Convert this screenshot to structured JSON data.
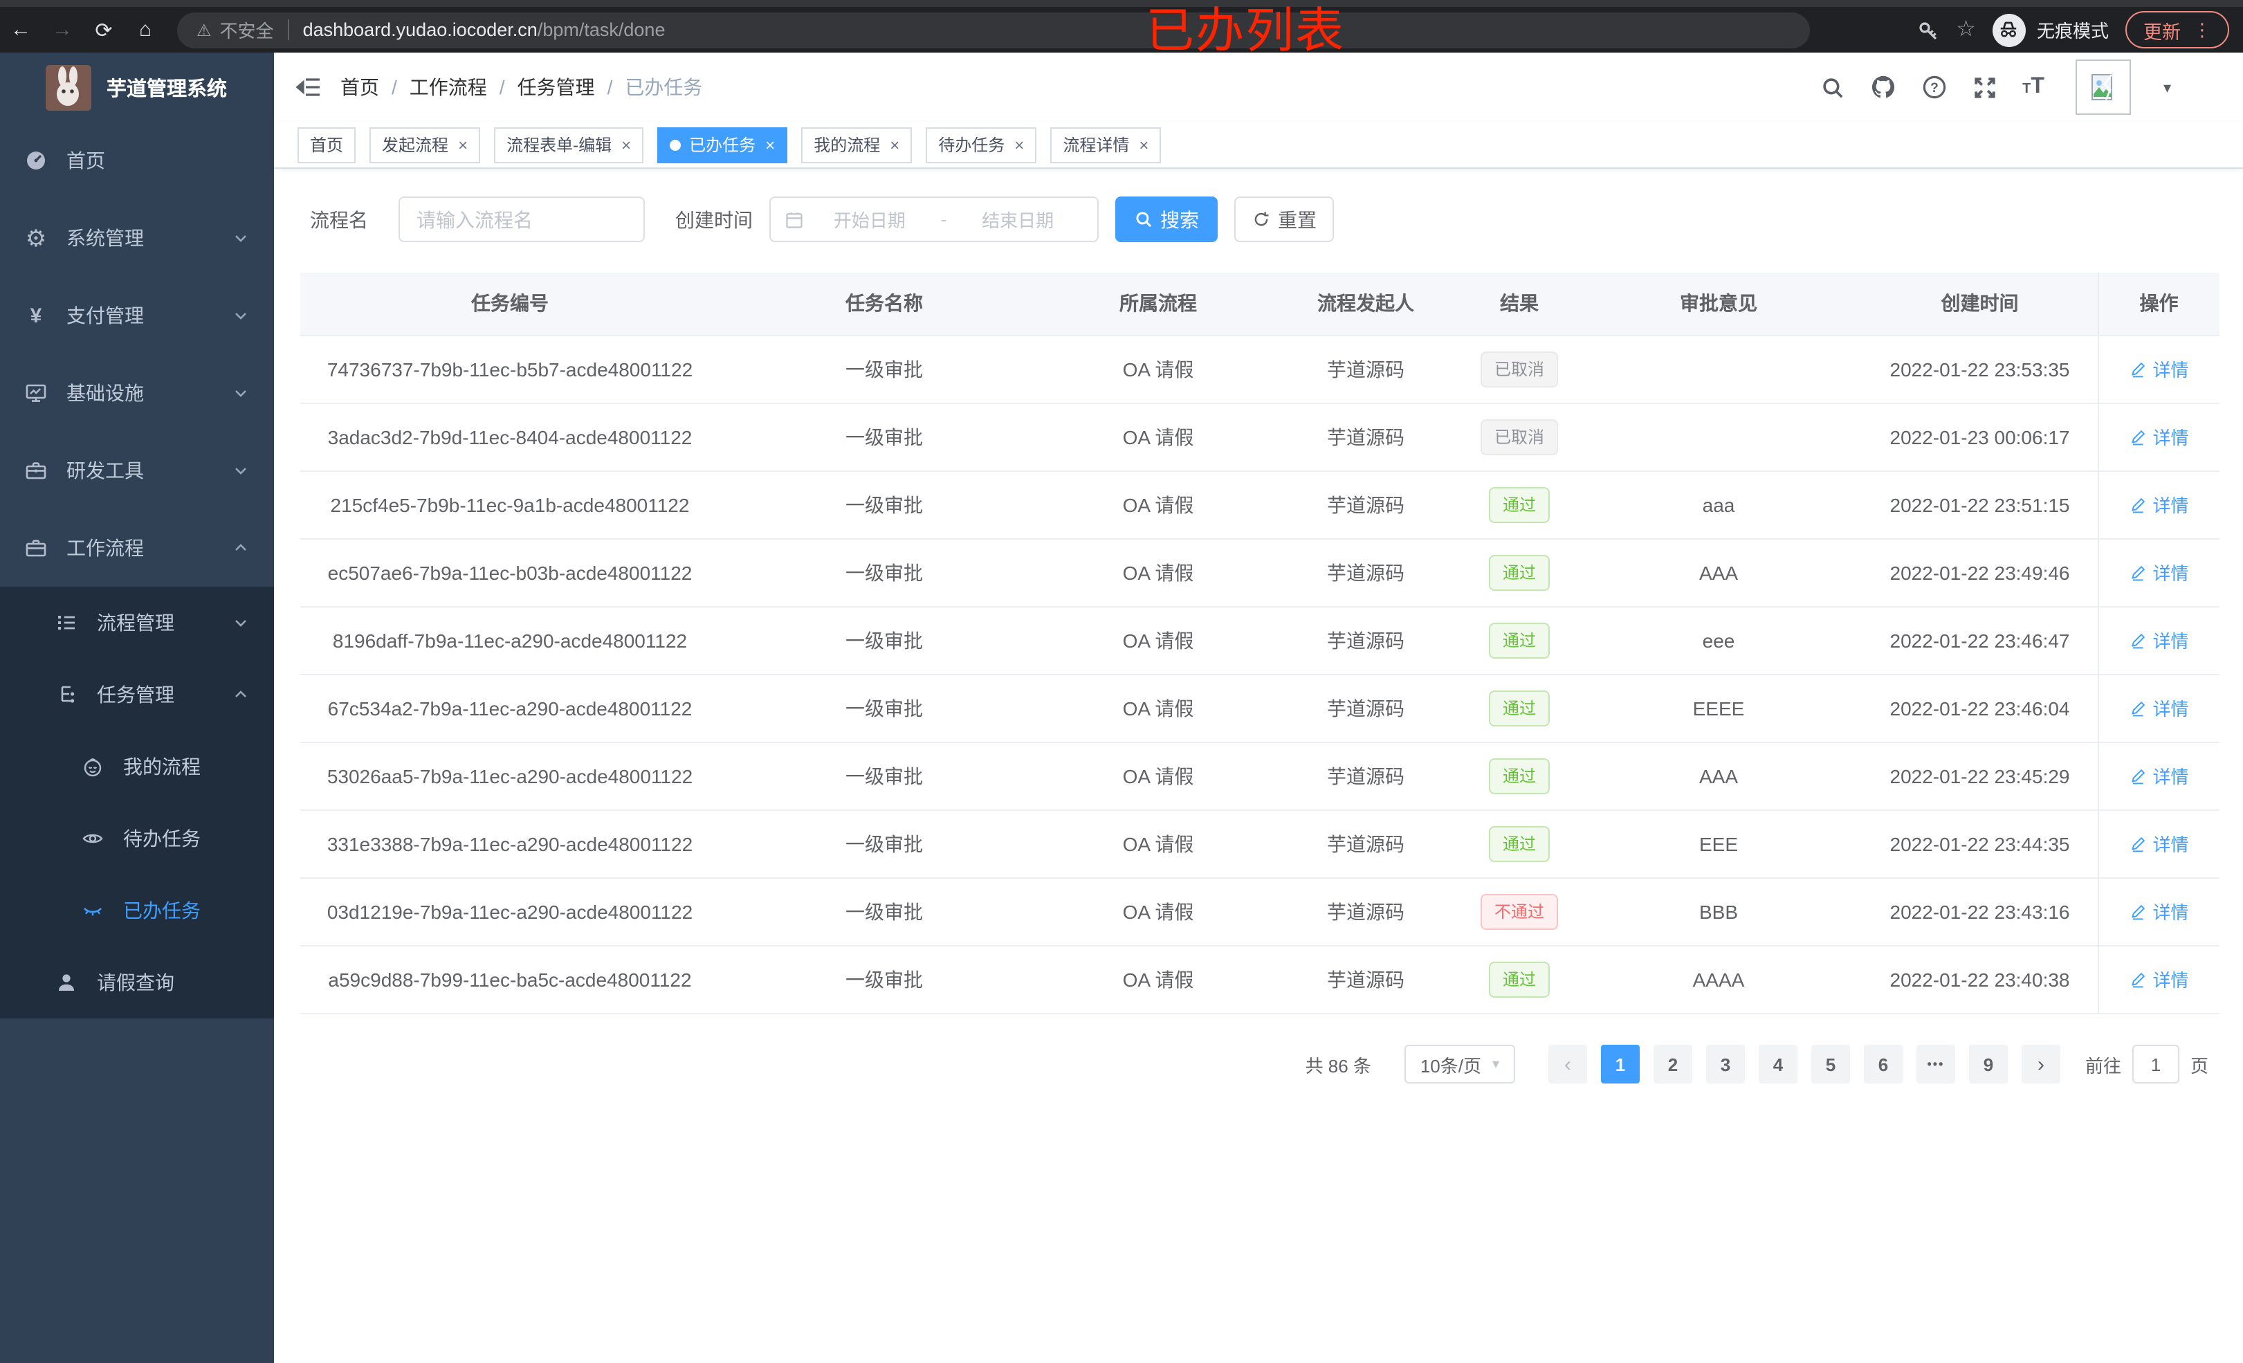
{
  "colors": {
    "primary": "#409eff",
    "success": "#67c23a",
    "danger": "#f56c6c",
    "info": "#909399",
    "sidebar_bg": "#304156",
    "submenu_bg": "#1f2d3d",
    "annotation_red": "#fe2400"
  },
  "browser": {
    "back_glyph": "←",
    "forward_glyph": "→",
    "refresh_glyph": "⟳",
    "home_glyph": "⌂",
    "warning_glyph": "⚠",
    "security_label": "不安全",
    "url_host": "dashboard.yudao.iocoder.cn",
    "url_path": "/bpm/task/done",
    "star_glyph": "☆",
    "incognito_label": "无痕模式",
    "update_label": "更新",
    "menu_dots_glyph": "⋮"
  },
  "annotation": {
    "text": "已办列表"
  },
  "sidebar": {
    "app_title": "芋道管理系统",
    "home": "首页",
    "system": "系统管理",
    "payment": "支付管理",
    "infra": "基础设施",
    "devtools": "研发工具",
    "workflow": "工作流程",
    "process_mgmt": "流程管理",
    "task_mgmt": "任务管理",
    "my_process": "我的流程",
    "todo_task": "待办任务",
    "done_task": "已办任务",
    "leave_query": "请假查询"
  },
  "navbar": {
    "breadcrumb": [
      "首页",
      "工作流程",
      "任务管理",
      "已办任务"
    ],
    "separator": "/"
  },
  "tabs": [
    {
      "label": "首页"
    },
    {
      "label": "发起流程"
    },
    {
      "label": "流程表单-编辑"
    },
    {
      "label": "已办任务"
    },
    {
      "label": "我的流程"
    },
    {
      "label": "待办任务"
    },
    {
      "label": "流程详情"
    }
  ],
  "ui": {
    "close_glyph": "×",
    "caret_glyph": "▾",
    "prev_glyph": "‹",
    "next_glyph": "›",
    "font_small": "T",
    "font_large": "T"
  },
  "filters": {
    "name_label": "流程名",
    "name_placeholder": "请输入流程名",
    "time_label": "创建时间",
    "start_placeholder": "开始日期",
    "range_separator": "-",
    "end_placeholder": "结束日期",
    "search_label": "搜索",
    "reset_label": "重置"
  },
  "table": {
    "columns": [
      "任务编号",
      "任务名称",
      "所属流程",
      "流程发起人",
      "结果",
      "审批意见",
      "创建时间",
      "操作"
    ],
    "action_label": "详情",
    "rows": [
      {
        "id": "74736737-7b9b-11ec-b5b7-acde48001122",
        "name": "一级审批",
        "process": "OA 请假",
        "starter": "芋道源码",
        "result": "已取消",
        "result_type": "info",
        "opinion": "",
        "created": "2022-01-22 23:53:35"
      },
      {
        "id": "3adac3d2-7b9d-11ec-8404-acde48001122",
        "name": "一级审批",
        "process": "OA 请假",
        "starter": "芋道源码",
        "result": "已取消",
        "result_type": "info",
        "opinion": "",
        "created": "2022-01-23 00:06:17"
      },
      {
        "id": "215cf4e5-7b9b-11ec-9a1b-acde48001122",
        "name": "一级审批",
        "process": "OA 请假",
        "starter": "芋道源码",
        "result": "通过",
        "result_type": "success",
        "opinion": "aaa",
        "created": "2022-01-22 23:51:15"
      },
      {
        "id": "ec507ae6-7b9a-11ec-b03b-acde48001122",
        "name": "一级审批",
        "process": "OA 请假",
        "starter": "芋道源码",
        "result": "通过",
        "result_type": "success",
        "opinion": "AAA",
        "created": "2022-01-22 23:49:46"
      },
      {
        "id": "8196daff-7b9a-11ec-a290-acde48001122",
        "name": "一级审批",
        "process": "OA 请假",
        "starter": "芋道源码",
        "result": "通过",
        "result_type": "success",
        "opinion": "eee",
        "created": "2022-01-22 23:46:47"
      },
      {
        "id": "67c534a2-7b9a-11ec-a290-acde48001122",
        "name": "一级审批",
        "process": "OA 请假",
        "starter": "芋道源码",
        "result": "通过",
        "result_type": "success",
        "opinion": "EEEE",
        "created": "2022-01-22 23:46:04"
      },
      {
        "id": "53026aa5-7b9a-11ec-a290-acde48001122",
        "name": "一级审批",
        "process": "OA 请假",
        "starter": "芋道源码",
        "result": "通过",
        "result_type": "success",
        "opinion": "AAA",
        "created": "2022-01-22 23:45:29"
      },
      {
        "id": "331e3388-7b9a-11ec-a290-acde48001122",
        "name": "一级审批",
        "process": "OA 请假",
        "starter": "芋道源码",
        "result": "通过",
        "result_type": "success",
        "opinion": "EEE",
        "created": "2022-01-22 23:44:35"
      },
      {
        "id": "03d1219e-7b9a-11ec-a290-acde48001122",
        "name": "一级审批",
        "process": "OA 请假",
        "starter": "芋道源码",
        "result": "不通过",
        "result_type": "danger",
        "opinion": "BBB",
        "created": "2022-01-22 23:43:16"
      },
      {
        "id": "a59c9d88-7b99-11ec-ba5c-acde48001122",
        "name": "一级审批",
        "process": "OA 请假",
        "starter": "芋道源码",
        "result": "通过",
        "result_type": "success",
        "opinion": "AAAA",
        "created": "2022-01-22 23:40:38"
      }
    ]
  },
  "pagination": {
    "total_label": "共 86 条",
    "page_size_label": "10条/页",
    "pages": [
      "1",
      "2",
      "3",
      "4",
      "5",
      "6",
      "•••",
      "9"
    ],
    "active_page": "1",
    "goto_label": "前往",
    "goto_value": "1",
    "page_unit_label": "页"
  }
}
